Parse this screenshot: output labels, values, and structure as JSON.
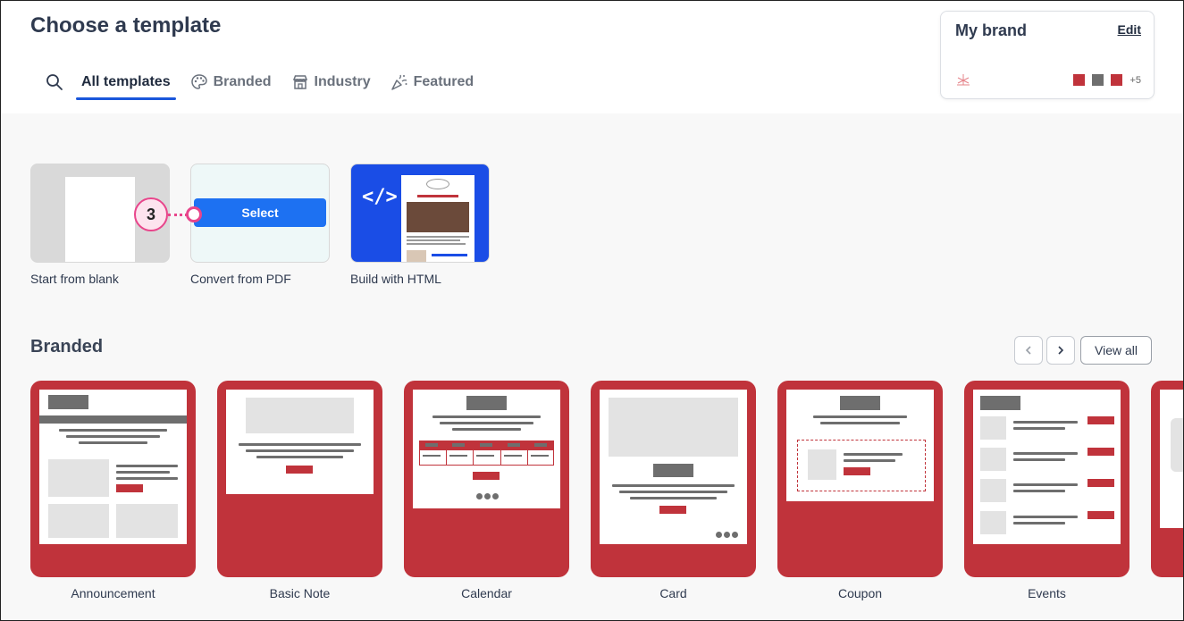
{
  "header": {
    "title": "Choose a template",
    "tabs": [
      {
        "label": "All templates",
        "icon": "search-icon",
        "active": true
      },
      {
        "label": "Branded",
        "icon": "palette-icon"
      },
      {
        "label": "Industry",
        "icon": "storefront-icon"
      },
      {
        "label": "Featured",
        "icon": "party-horn-icon"
      }
    ]
  },
  "brand": {
    "title": "My brand",
    "edit_label": "Edit",
    "colors": [
      "#c0333b",
      "#6e6e6e",
      "#c0333b"
    ],
    "more_colors": "+5"
  },
  "starters": [
    {
      "label": "Start from blank"
    },
    {
      "label": "Convert from PDF",
      "hover_button": "Select"
    },
    {
      "label": "Build with HTML"
    }
  ],
  "callout": {
    "number": "3"
  },
  "branded": {
    "title": "Branded",
    "view_all_label": "View all",
    "templates": [
      {
        "label": "Announcement"
      },
      {
        "label": "Basic Note"
      },
      {
        "label": "Calendar"
      },
      {
        "label": "Card"
      },
      {
        "label": "Coupon"
      },
      {
        "label": "Events"
      }
    ]
  },
  "colors": {
    "accent": "#1d71f2",
    "brand_red": "#c0333b",
    "callout": "#e8458b"
  }
}
